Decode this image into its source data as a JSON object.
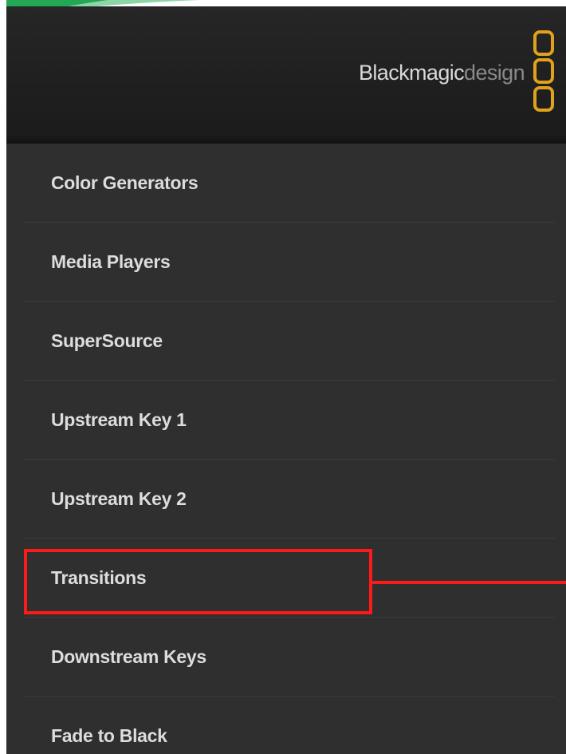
{
  "brand": {
    "name_primary": "Blackmagic",
    "name_secondary": "design",
    "logo_icon": "three-rounded-squares-logo-icon",
    "logo_color": "#e0a21a"
  },
  "menu": {
    "items": [
      {
        "label": "Color Generators"
      },
      {
        "label": "Media Players"
      },
      {
        "label": "SuperSource"
      },
      {
        "label": "Upstream Key 1"
      },
      {
        "label": "Upstream Key 2"
      },
      {
        "label": "Transitions",
        "highlighted": true
      },
      {
        "label": "Downstream Keys"
      },
      {
        "label": "Fade to Black"
      }
    ]
  },
  "annotation": {
    "color": "#ff1a1a",
    "target": "Transitions"
  },
  "colors": {
    "panel_background": "#2f2f2f",
    "header_background": "#1f1f1f",
    "menu_text": "#dddddd",
    "slide_accent_green": "#1a9a4a"
  }
}
